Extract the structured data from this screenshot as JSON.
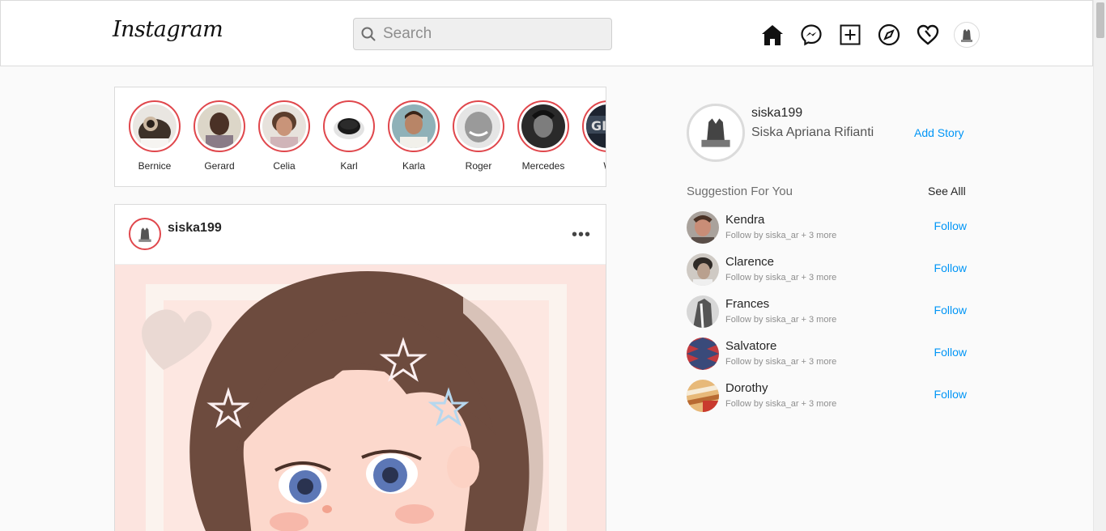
{
  "header": {
    "logo": "Instagram",
    "search_placeholder": "Search"
  },
  "stories": [
    {
      "name": "Bernice"
    },
    {
      "name": "Gerard"
    },
    {
      "name": "Celia"
    },
    {
      "name": "Karl"
    },
    {
      "name": "Karla"
    },
    {
      "name": "Roger"
    },
    {
      "name": "Mercedes"
    },
    {
      "name": "W"
    }
  ],
  "post": {
    "username": "siska199",
    "menu": "•••"
  },
  "profile": {
    "username": "siska199",
    "full_name": "Siska Apriana Rifianti",
    "add_story_label": "Add Story"
  },
  "suggestions": {
    "title": "Suggestion For You",
    "see_all_label": "See Alll",
    "items": [
      {
        "name": "Kendra",
        "sub": "Follow by siska_ar + 3 more",
        "follow_label": "Follow"
      },
      {
        "name": "Clarence",
        "sub": "Follow by siska_ar + 3 more",
        "follow_label": "Follow"
      },
      {
        "name": "Frances",
        "sub": "Follow by siska_ar + 3 more",
        "follow_label": "Follow"
      },
      {
        "name": "Salvatore",
        "sub": "Follow by siska_ar + 3 more",
        "follow_label": "Follow"
      },
      {
        "name": "Dorothy",
        "sub": "Follow by siska_ar + 3 more",
        "follow_label": "Follow"
      }
    ]
  },
  "colors": {
    "accent": "#0095f6",
    "story_ring": "#e0474c",
    "background": "#fafafa"
  },
  "icons": [
    "search-icon",
    "home-icon",
    "messenger-icon",
    "new-post-icon",
    "explore-icon",
    "activity-heart-icon"
  ]
}
